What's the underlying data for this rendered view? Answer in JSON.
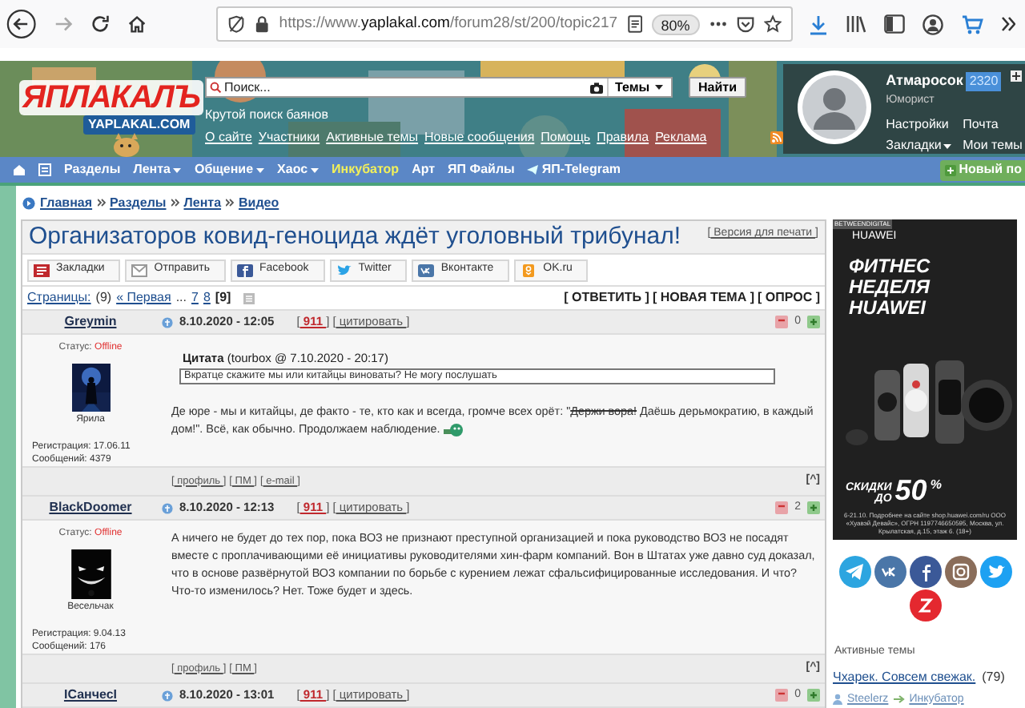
{
  "browser": {
    "url": {
      "scheme": "https://www.",
      "domain": "yaplakal.com",
      "path": "/forum28/st/200/topic217"
    },
    "zoom": "80%"
  },
  "header": {
    "logo": "ЯПЛАКАЛЪ",
    "logo_sub": "YAPLAKAL.COM",
    "search": {
      "placeholder": "Поиск...",
      "scope": "Темы",
      "button": "Найти"
    },
    "tagline": "Крутой поиск баянов",
    "links": [
      "О сайте",
      "Участники",
      "Активные темы",
      "Новые сообщения",
      "Помощь",
      "Правила",
      "Реклама"
    ],
    "user": {
      "name": "Атмаросок",
      "karma": "2320",
      "rank": "Юморист",
      "links": [
        {
          "label": "Настройки",
          "dropdown": false
        },
        {
          "label": "Почта",
          "dropdown": false
        },
        {
          "label": "Закладки",
          "dropdown": true
        },
        {
          "label": "Мои темы",
          "dropdown": false
        }
      ]
    }
  },
  "nav": {
    "items": [
      {
        "kind": "home"
      },
      {
        "kind": "list"
      },
      {
        "kind": "text",
        "label": "Разделы",
        "dropdown": false,
        "highlight": false
      },
      {
        "kind": "text",
        "label": "Лента",
        "dropdown": true,
        "highlight": false
      },
      {
        "kind": "text",
        "label": "Общение",
        "dropdown": true,
        "highlight": false
      },
      {
        "kind": "text",
        "label": "Хаос",
        "dropdown": true,
        "highlight": false
      },
      {
        "kind": "text",
        "label": "Инкубатор",
        "dropdown": false,
        "highlight": true
      },
      {
        "kind": "text",
        "label": "Арт",
        "dropdown": false,
        "highlight": false
      },
      {
        "kind": "text",
        "label": "ЯП Файлы",
        "dropdown": false,
        "highlight": false
      },
      {
        "kind": "telegram",
        "label": "ЯП-Telegram",
        "dropdown": false,
        "highlight": false
      }
    ],
    "new_button": "Новый по"
  },
  "breadcrumbs": [
    "Главная",
    "Разделы",
    "Лента",
    "Видео"
  ],
  "topic": {
    "title": "Организаторов ковид-геноцида ждёт уголовный трибунал!",
    "print": "[ Версия для печати ]",
    "share": [
      {
        "kind": "bookmarks",
        "label": "Закладки"
      },
      {
        "kind": "mail",
        "label": "Отправить"
      },
      {
        "kind": "facebook",
        "label": "Facebook"
      },
      {
        "kind": "twitter",
        "label": "Twitter"
      },
      {
        "kind": "vk",
        "label": "Вконтакте"
      },
      {
        "kind": "ok",
        "label": "OK.ru"
      }
    ],
    "pages_label": "Страницы:",
    "pages_count": "(9)",
    "pages_gap": "...",
    "pages": [
      {
        "label": "« Первая",
        "selected": false
      },
      {
        "label": "7",
        "selected": false
      },
      {
        "label": "8",
        "selected": false
      },
      {
        "label": "[9]",
        "selected": true
      }
    ],
    "actions": [
      "[ ОТВЕТИТЬ ]",
      "[ НОВАЯ ТЕМА ]",
      "[ ОПРОС ]"
    ]
  },
  "posts": [
    {
      "author": "Greymin",
      "date": "8.10.2020 - 12:05",
      "number": "[ 911 ]",
      "quote_link": "[ цитировать ]",
      "rating": "0",
      "status_label": "Статус:",
      "status": "Offline",
      "title": "Ярила",
      "registered": "Регистрация: 17.06.11",
      "messages": "Сообщений: 4379",
      "quote": {
        "header": "Цитата",
        "source": "(tourbox @ 7.10.2020 - 20:17)",
        "text": "Вкратце скажите мы или китайцы виноваты? Не могу послушать"
      },
      "body": [
        {
          "text": "Де юре - мы и китайцы, де факто - те, кто как и всегда, громче всех орёт: \"",
          "struck": false
        },
        {
          "text": "Держи вора!",
          "struck": true
        },
        {
          "text": " Даёшь дерьмократию, в каждый дом!\". Всё, как обычно. Продолжаем наблюдение.",
          "struck": false
        }
      ],
      "smiley": true,
      "footer": [
        "[ профиль ]",
        "[ ПМ ]",
        "[ e-mail ]"
      ],
      "top": "[^]"
    },
    {
      "author": "BlackDoomer",
      "date": "8.10.2020 - 12:13",
      "number": "[ 911 ]",
      "quote_link": "[ цитировать ]",
      "rating": "2",
      "status_label": "Статус:",
      "status": "Offline",
      "title": "Весельчак",
      "registered": "Регистрация: 9.04.13",
      "messages": "Сообщений: 176",
      "body": [
        {
          "text": "А ничего не будет до тех пор, пока ВОЗ не признают преступной организацией и пока руководство ВОЗ не посадят вместе с проплачивающими её инициативы руководителями хин-фарм компаний. Вон в Штатах уже давно суд доказал, что в основе развёрнутой ВОЗ компании по борьбе с курением лежат сфальсифицированные исследования. И что? Что-то изменилось? Нет. Тоже будет и здесь.",
          "struck": false
        }
      ],
      "smiley": false,
      "footer": [
        "[ профиль ]",
        "[ ПМ ]"
      ],
      "top": "[^]"
    },
    {
      "author": "IСанчесI",
      "date": "8.10.2020 - 13:01",
      "number": "[ 911 ]",
      "quote_link": "[ цитировать ]",
      "rating": "0"
    }
  ],
  "sidebar": {
    "ad": {
      "network": "BETWEENDIGITAL",
      "brand": "HUAWEI",
      "headline": [
        "ФИТНЕС",
        "НЕДЕЛЯ",
        "HUAWEI"
      ],
      "sale_top": "СКИДКИ",
      "sale_bottom": "ДО",
      "sale_value": "50",
      "sale_unit": "%",
      "legal": "6-21.10. Подробнее на сайте shop.huawei.com/ru ООО «Хуавэй Девайс», ОГРН 1197746650595, Москва, ул. Крылатская, д.15, этаж 6. (18+)"
    },
    "active_title": "Активные темы",
    "active_topic": {
      "title": "Чхарек. Совсем свежак.",
      "count": "(79)",
      "author": "Steelerz",
      "section": "Инкубатор"
    }
  }
}
